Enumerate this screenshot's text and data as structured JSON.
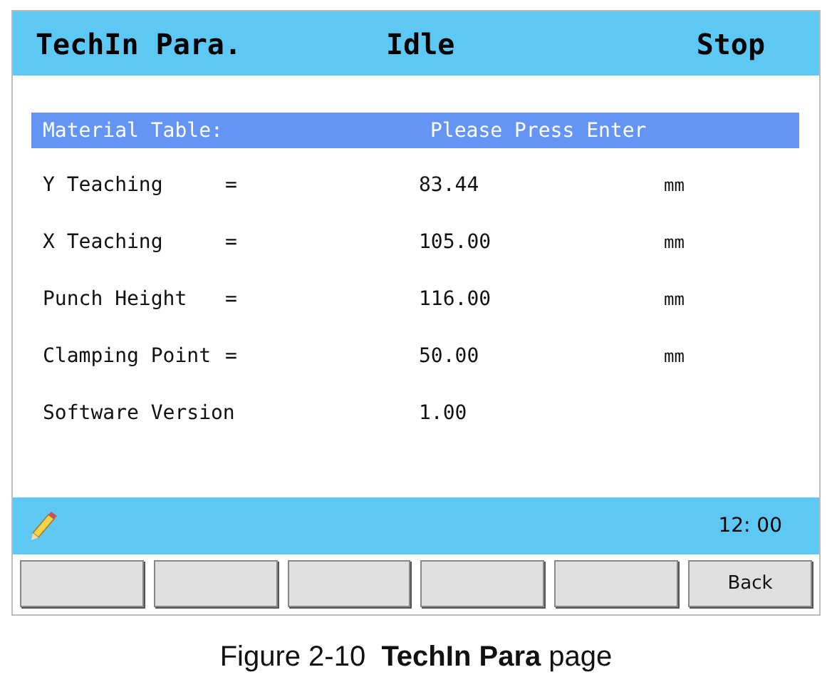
{
  "header": {
    "title": "TechIn Para.",
    "status": "Idle",
    "state": "Stop"
  },
  "material_bar": {
    "label": "Material Table:",
    "value": "Please Press Enter"
  },
  "parameters": [
    {
      "name": "Y Teaching",
      "equals": "=",
      "value": "83.44",
      "unit": "mm"
    },
    {
      "name": "X Teaching",
      "equals": "=",
      "value": "105.00",
      "unit": "mm"
    },
    {
      "name": "Punch Height",
      "equals": "=",
      "value": "116.00",
      "unit": "mm"
    },
    {
      "name": "Clamping Point",
      "equals": "=",
      "value": "50.00",
      "unit": "mm"
    },
    {
      "name": "Software Version",
      "value": "1.00"
    }
  ],
  "status_bar": {
    "time": "12: 00"
  },
  "buttons": [
    {
      "kind": "blank"
    },
    {
      "kind": "blank"
    },
    {
      "kind": "blank"
    },
    {
      "kind": "blank"
    },
    {
      "kind": "blank"
    },
    {
      "kind": "key",
      "label": "Back"
    }
  ],
  "caption": "Figure 2-10  **TechIn Para** page"
}
